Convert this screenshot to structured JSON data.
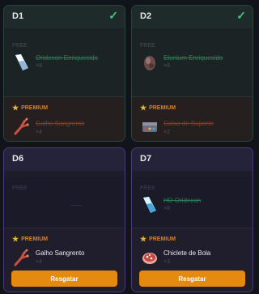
{
  "cards": [
    {
      "day": "D1",
      "checkmark": "✓",
      "free_label": "FREE",
      "free_item": {
        "name": "Oridecon Enriquecido",
        "qty": "×8",
        "icon": "crystal-icon"
      },
      "premium_label": "PREMIUM",
      "premium_item": {
        "name": "Galho Sangrento",
        "qty": "×4",
        "icon": "branch-icon"
      }
    },
    {
      "day": "D2",
      "checkmark": "✓",
      "free_label": "FREE",
      "free_item": {
        "name": "Elunium Enriquecido",
        "qty": "×8",
        "icon": "stone-icon"
      },
      "premium_label": "PREMIUM",
      "premium_item": {
        "name": "Caixa de Suporte",
        "qty": "×2",
        "icon": "box-icon"
      }
    },
    {
      "day": "D6",
      "free_label": "FREE",
      "premium_label": "PREMIUM",
      "premium_item": {
        "name": "Galho Sangrento",
        "qty": "×4",
        "icon": "branch-icon"
      },
      "button": "Resgatar"
    },
    {
      "day": "D7",
      "free_label": "FREE",
      "free_item": {
        "name": "HD Oridecon",
        "qty": "×8",
        "icon": "crystal-icon"
      },
      "premium_label": "PREMIUM",
      "premium_item": {
        "name": "Chiclete de Bola",
        "qty": "×3",
        "icon": "candy-icon"
      },
      "button": "Resgatar"
    }
  ],
  "colors": {
    "claimed_check": "#3ec97a",
    "premium_label": "#d9802a",
    "button": "#e48a10"
  }
}
